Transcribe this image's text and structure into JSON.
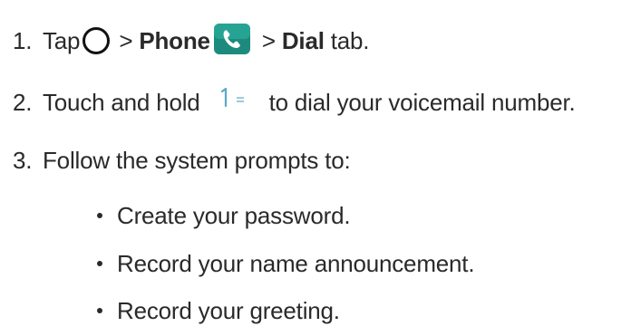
{
  "steps": [
    {
      "number": "1.",
      "parts": {
        "t1": "Tap",
        "t2": " > ",
        "bold1": "Phone",
        "t3": " > ",
        "bold2": "Dial",
        "t4": " tab."
      }
    },
    {
      "number": "2.",
      "parts": {
        "t1": "Touch and hold",
        "t2": "to dial your voicemail number."
      }
    },
    {
      "number": "3.",
      "parts": {
        "t1": "Follow the system prompts to:"
      }
    }
  ],
  "bullets": [
    "Create your password.",
    "Record your name announcement.",
    "Record your greeting."
  ],
  "icons": {
    "home": "home-circle-icon",
    "phone": "phone-app-icon",
    "key1": "dial-key-1-voicemail-icon"
  },
  "colors": {
    "text": "#2a2a2a",
    "phone_icon_bg": "#1d8a7e",
    "key_color": "#5aa9c8"
  }
}
